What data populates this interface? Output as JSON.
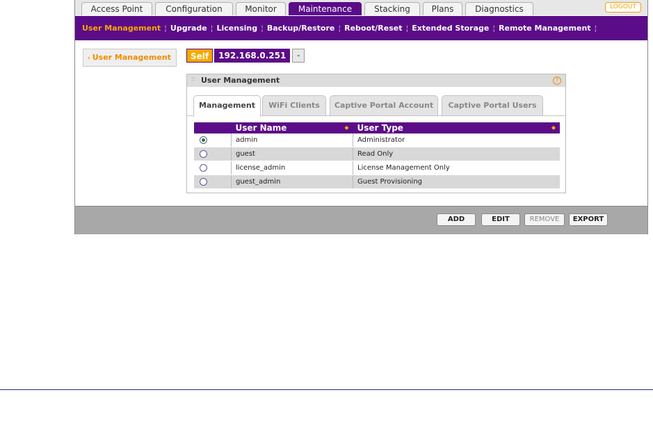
{
  "top_tabs": [
    {
      "label": "Access Point"
    },
    {
      "label": "Configuration"
    },
    {
      "label": "Monitor"
    },
    {
      "label": "Maintenance"
    },
    {
      "label": "Stacking"
    },
    {
      "label": "Plans"
    },
    {
      "label": "Diagnostics"
    }
  ],
  "logout_label": "LOGOUT",
  "subnav": [
    {
      "label": "User Management"
    },
    {
      "label": "Upgrade"
    },
    {
      "label": "Licensing"
    },
    {
      "label": "Backup/Restore"
    },
    {
      "label": "Reboot/Reset"
    },
    {
      "label": "Extended Storage"
    },
    {
      "label": "Remote Management"
    }
  ],
  "left_nav": {
    "item": "User Management"
  },
  "ap_selector": {
    "self": "Self",
    "ip": "192.168.0.251",
    "dropdown": "-"
  },
  "panel": {
    "title": "User Management",
    "help_icon": "?",
    "tabs": [
      {
        "label": "Management"
      },
      {
        "label": "WiFi Clients"
      },
      {
        "label": "Captive Portal Account"
      },
      {
        "label": "Captive Portal Users"
      }
    ],
    "table": {
      "headers": [
        "User Name",
        "User Type"
      ],
      "rows": [
        {
          "name": "admin",
          "type": "Administrator",
          "selected": true
        },
        {
          "name": "guest",
          "type": "Read Only",
          "selected": false
        },
        {
          "name": "license_admin",
          "type": "License Management Only",
          "selected": false
        },
        {
          "name": "guest_admin",
          "type": "Guest Provisioning",
          "selected": false
        }
      ]
    }
  },
  "footer": {
    "add": "ADD",
    "edit": "EDIT",
    "remove": "REMOVE",
    "export": "EXPORT"
  },
  "colors": {
    "brand_purple": "#5b0c88",
    "accent_orange": "#f6a800"
  },
  "icons": {
    "help": "help-icon",
    "sort": "sort-icon",
    "dropdown": "chevron-down-icon"
  }
}
